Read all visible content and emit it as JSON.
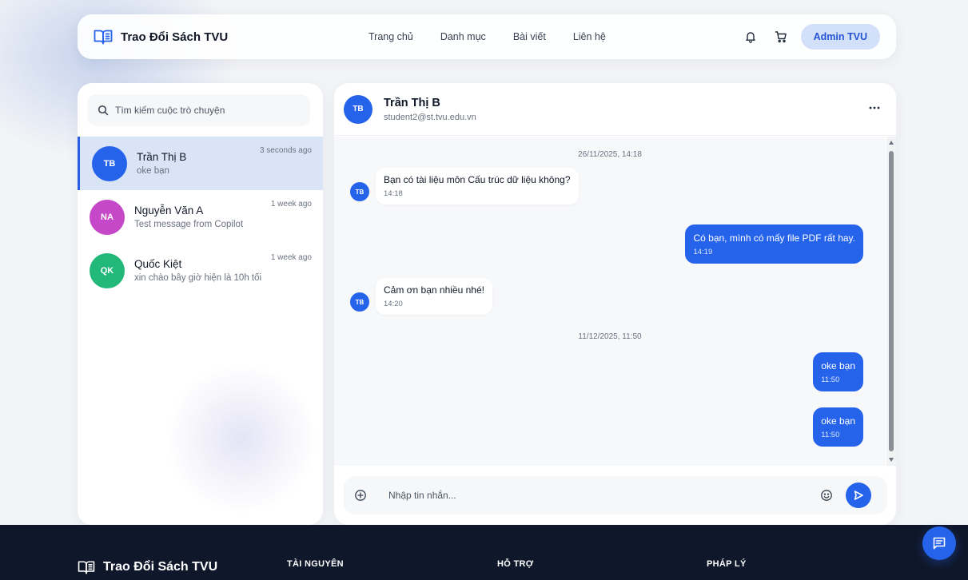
{
  "colors": {
    "accent": "#2563eb",
    "footer_bg": "#0f172a",
    "active_row": "#d9e4f7"
  },
  "header": {
    "brand_name": "Trao Đổi Sách TVU",
    "brand_icon": "open-book-icon",
    "nav": [
      "Trang chủ",
      "Danh mục",
      "Bài viết",
      "Liên hệ"
    ],
    "notification_icon": "bell-icon",
    "cart_icon": "cart-icon",
    "account_label": "Admin TVU"
  },
  "sidebar": {
    "search_placeholder": "Tìm kiếm cuộc trò chuyện",
    "conversations": [
      {
        "initials": "TB",
        "name": "Trần Thị B",
        "preview": "oke bạn",
        "time": "3 seconds ago",
        "color": "#2563eb",
        "active": true
      },
      {
        "initials": "NA",
        "name": "Nguyễn Văn A",
        "preview": "Test message from Copilot",
        "time": "1 week ago",
        "color": "#c548c8",
        "active": false
      },
      {
        "initials": "QK",
        "name": "Quốc Kiệt",
        "preview": "xin chào bây giờ hiện là 10h tối",
        "time": "1 week ago",
        "color": "#22b87a",
        "active": false
      }
    ]
  },
  "chat": {
    "contact": {
      "initials": "TB",
      "name": "Trần Thị B",
      "email": "student2@st.tvu.edu.vn"
    },
    "more_icon": "more-horizontal-icon",
    "date_separators": [
      "26/11/2025, 14:18",
      "11/12/2025, 11:50"
    ],
    "messages": [
      {
        "direction": "in",
        "text": "Bạn có tài liệu môn Cấu trúc dữ liệu không?",
        "time": "14:18"
      },
      {
        "direction": "out",
        "text": "Có bạn, mình có mấy file PDF rất hay.",
        "time": "14:19"
      },
      {
        "direction": "in",
        "text": "Cảm ơn bạn nhiều nhé!",
        "time": "14:20"
      },
      {
        "direction": "out",
        "text": "oke bạn",
        "time": "11:50"
      },
      {
        "direction": "out",
        "text": "oke bạn",
        "time": "11:50"
      }
    ],
    "composer_placeholder": "Nhập tin nhắn..."
  },
  "footer": {
    "brand_name": "Trao Đổi Sách TVU",
    "columns": [
      "TÀI NGUYÊN",
      "HỖ TRỢ",
      "PHÁP LÝ"
    ]
  },
  "fab_icon": "chat-message-icon"
}
